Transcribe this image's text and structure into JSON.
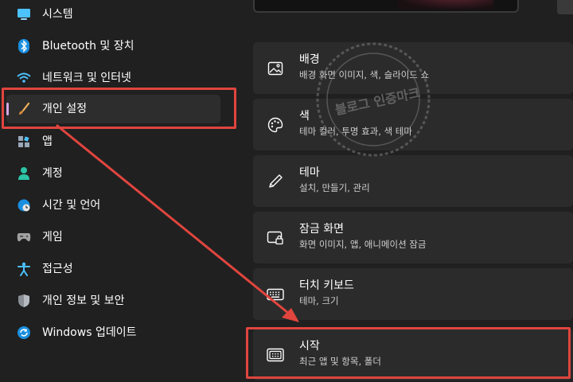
{
  "sidebar": {
    "items": [
      {
        "label": "시스템",
        "icon": "monitor-icon"
      },
      {
        "label": "Bluetooth 및 장치",
        "icon": "bluetooth-icon"
      },
      {
        "label": "네트워크 및 인터넷",
        "icon": "wifi-icon"
      },
      {
        "label": "개인 설정",
        "icon": "brush-icon"
      },
      {
        "label": "앱",
        "icon": "apps-icon"
      },
      {
        "label": "계정",
        "icon": "person-icon"
      },
      {
        "label": "시간 및 언어",
        "icon": "globe-clock-icon"
      },
      {
        "label": "게임",
        "icon": "gamepad-icon"
      },
      {
        "label": "접근성",
        "icon": "accessibility-icon"
      },
      {
        "label": "개인 정보 및 보안",
        "icon": "shield-icon"
      },
      {
        "label": "Windows 업데이트",
        "icon": "update-icon"
      }
    ],
    "active_index": 3
  },
  "cards": [
    {
      "title": "배경",
      "subtitle": "배경 화면 이미지, 색, 슬라이드 쇼",
      "icon": "image-icon"
    },
    {
      "title": "색",
      "subtitle": "테마 컬러, 투명 효과, 색 테마",
      "icon": "palette-icon"
    },
    {
      "title": "테마",
      "subtitle": "설치, 만들기, 관리",
      "icon": "pen-icon"
    },
    {
      "title": "잠금 화면",
      "subtitle": "화면 이미지, 앱, 애니메이션 잠금",
      "icon": "lock-screen-icon"
    },
    {
      "title": "터치 키보드",
      "subtitle": "테마, 크기",
      "icon": "keyboard-icon"
    },
    {
      "title": "시작",
      "subtitle": "최근 앱 및 항목, 폴더",
      "icon": "start-icon"
    }
  ],
  "watermark": {
    "text": "블로그 인증마크"
  },
  "colors": {
    "background": "#202020",
    "card": "#2b2b2b",
    "active_pill": "#d7a6e8",
    "annotation_red": "#e0453e",
    "accent_blue": "#4cc2ff"
  }
}
